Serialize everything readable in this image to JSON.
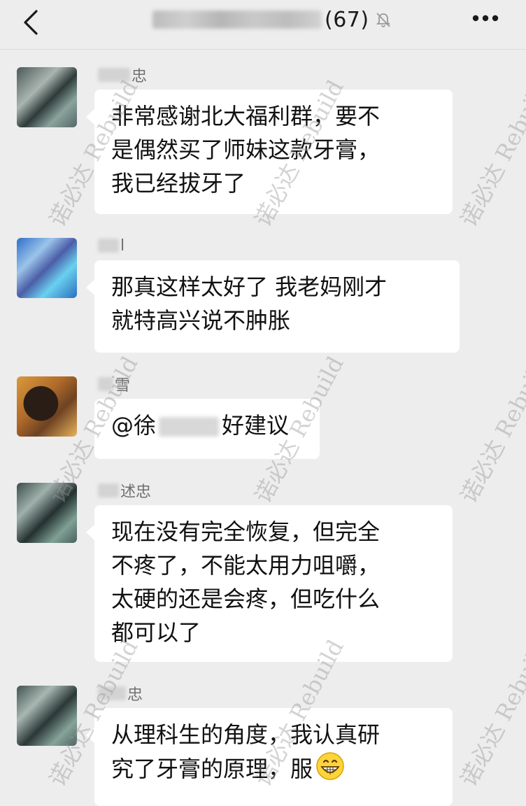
{
  "header": {
    "group_name_obscured": true,
    "member_count": "(67)",
    "back_icon": "chevron-left-icon",
    "mute_icon": "bell-muted-icon",
    "more_icon": "more-dots-icon"
  },
  "messages": [
    {
      "sender_visible": "忠",
      "lines": [
        "非常感谢北大福利群，要不",
        "是偶然买了师妹这款牙膏，",
        "我已经拔牙了"
      ]
    },
    {
      "sender_visible": "l",
      "lines": [
        "那真这样太好了 我老妈刚才",
        "就特高兴说不肿胀"
      ]
    },
    {
      "sender_visible": "雪",
      "mention_prefix": "@徐",
      "mention_suffix": "好建议"
    },
    {
      "sender_visible": "述忠",
      "lines": [
        "现在没有完全恢复，但完全",
        "不疼了，不能太用力咀嚼，",
        "太硬的还是会疼，但吃什么",
        "都可以了"
      ]
    },
    {
      "sender_visible": "忠",
      "lines": [
        "从理科生的角度，我认真研",
        "究了牙膏的原理，服"
      ],
      "emoji": "grinning-face-icon"
    }
  ],
  "watermark": {
    "text": "诺必达 Rebuild"
  },
  "colors": {
    "background": "#ededed",
    "bubble": "#ffffff",
    "text": "#111111"
  }
}
